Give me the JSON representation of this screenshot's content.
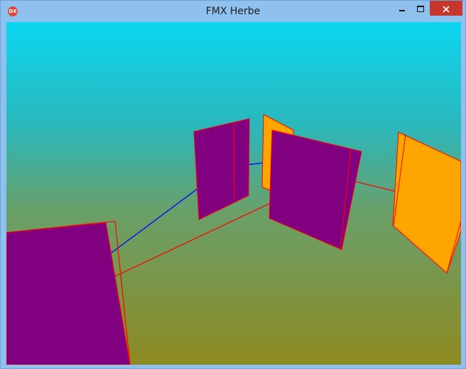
{
  "window": {
    "title": "FMX Herbe",
    "app_icon": "DX"
  },
  "controls": {
    "minimize": "minimize-icon",
    "maximize": "maximize-icon",
    "close": "close-icon"
  },
  "colors": {
    "sky_top": "#0cd6f1",
    "ground_bottom": "#8e8a22",
    "panel_purple": "#800080",
    "panel_orange": "#ffa500",
    "line_red": "#ff0000",
    "line_blue": "#0000ff"
  }
}
